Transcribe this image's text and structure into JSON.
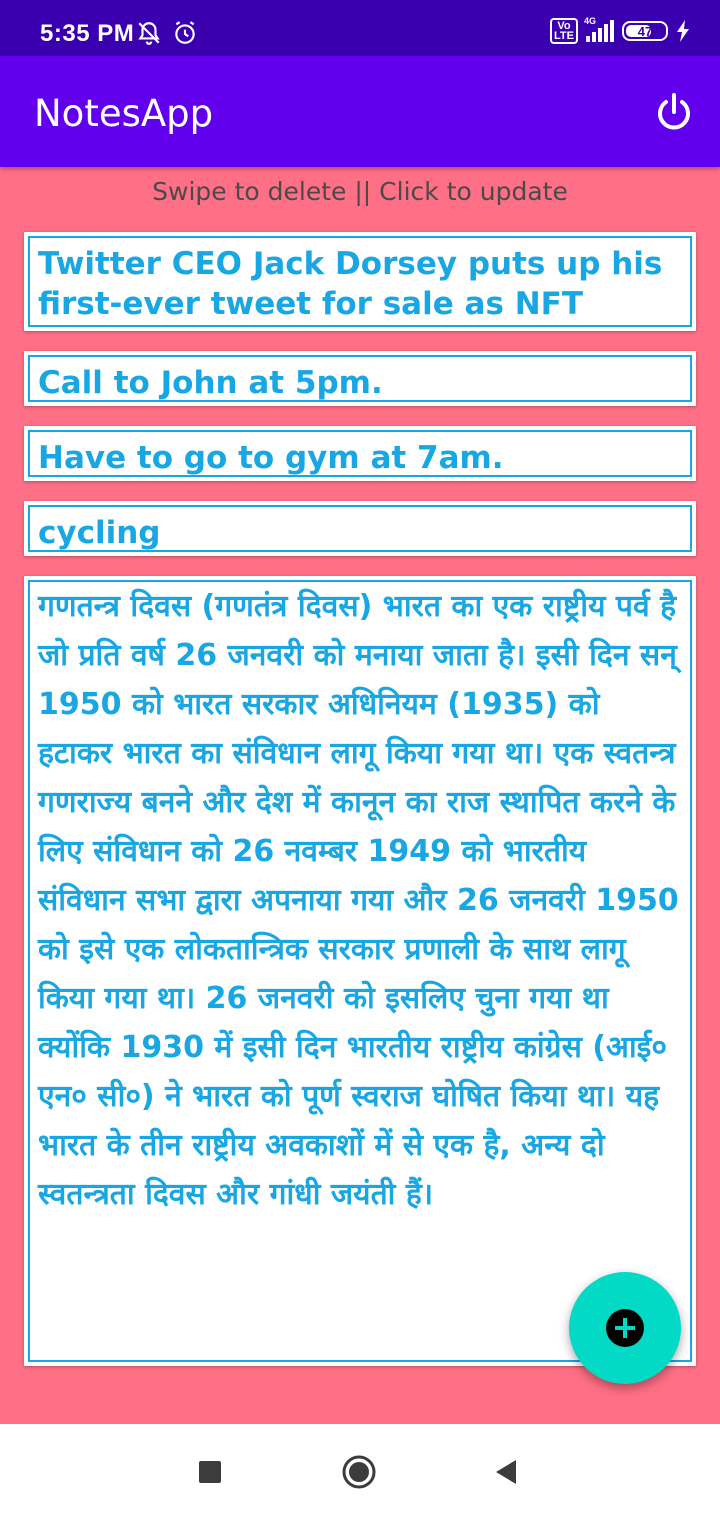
{
  "status_bar": {
    "time": "5:35 PM",
    "network": "4G",
    "volte": "Vo\nLTE",
    "battery": "47"
  },
  "app_bar": {
    "title": "NotesApp"
  },
  "hint": "Swipe to delete || Click to update",
  "notes": [
    {
      "text": "Twitter CEO Jack Dorsey puts up his first-ever tweet for sale as NFT"
    },
    {
      "text": "Call to John at 5pm."
    },
    {
      "text": "Have to go to gym at 7am."
    },
    {
      "text": "cycling"
    },
    {
      "text": "गणतन्त्र दिवस (गणतंत्र दिवस) भारत का एक राष्ट्रीय पर्व है जो प्रति वर्ष 26 जनवरी को मनाया जाता है। इसी दिन सन् 1950 को भारत सरकार अधिनियम (1935) को हटाकर भारत का संविधान लागू किया गया था। एक स्वतन्त्र गणराज्य बनने और देश में कानून का राज स्थापित करने के लिए संविधान को 26 नवम्बर 1949 को भारतीय संविधान सभा द्वारा अपनाया गया और 26 जनवरी 1950 को इसे एक लोकतान्त्रिक सरकार प्रणाली के साथ लागू किया गया था। 26 जनवरी को इसलिए चुना गया था क्योंकि 1930 में इसी दिन भारतीय राष्ट्रीय कांग्रेस (आई० एन० सी०) ने भारत को पूर्ण स्वराज घोषित किया था। यह भारत के तीन राष्ट्रीय अवकाशों में से एक है, अन्य दो स्वतन्त्रता दिवस और गांधी जयंती हैं।"
    }
  ],
  "colors": {
    "status_bar": "#3a00b0",
    "app_bar": "#6200ee",
    "background": "#ff6f85",
    "note_text": "#18a7e2",
    "fab": "#03dac5"
  },
  "icons": {
    "power": "power-icon",
    "fab": "add-icon",
    "nav": [
      "recents-icon",
      "home-icon",
      "back-icon"
    ]
  }
}
